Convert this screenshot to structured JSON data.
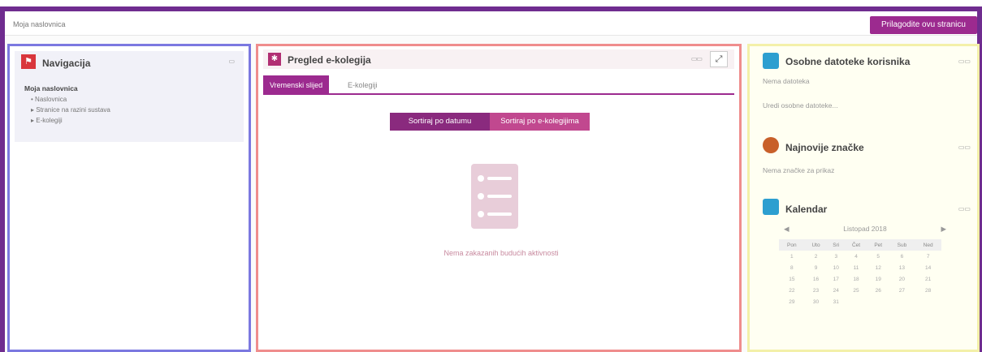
{
  "breadcrumb": "Moja naslovnica",
  "customize_button": "Prilagodite ovu stranicu",
  "navigation": {
    "title": "Navigacija",
    "root": "Moja naslovnica",
    "items": [
      {
        "label": "Naslovnica",
        "marker": "•"
      },
      {
        "label": "Stranice na razini sustava",
        "marker": "▸"
      },
      {
        "label": "E-kolegiji",
        "marker": "▸"
      }
    ]
  },
  "overview": {
    "title": "Pregled e-kolegija",
    "tabs": [
      "Vremenski slijed",
      "E-kolegiji"
    ],
    "sort_buttons": [
      "Sortiraj po datumu",
      "Sortiraj po e-kolegijima"
    ],
    "empty_text": "Nema zakazanih budućih aktivnosti"
  },
  "files": {
    "title": "Osobne datoteke korisnika",
    "empty": "Nema datoteka",
    "edit_link": "Uredi osobne datoteke..."
  },
  "badges": {
    "title": "Najnovije značke",
    "empty": "Nema značke za prikaz"
  },
  "calendar": {
    "title": "Kalendar",
    "month": "Listopad 2018",
    "weekdays": [
      "Pon",
      "Uto",
      "Sri",
      "Čet",
      "Pet",
      "Sub",
      "Ned"
    ],
    "weeks": [
      [
        "1",
        "2",
        "3",
        "4",
        "5",
        "6",
        "7"
      ],
      [
        "8",
        "9",
        "10",
        "11",
        "12",
        "13",
        "14"
      ],
      [
        "15",
        "16",
        "17",
        "18",
        "19",
        "20",
        "21"
      ],
      [
        "22",
        "23",
        "24",
        "25",
        "26",
        "27",
        "28"
      ],
      [
        "29",
        "30",
        "31",
        "",
        "",
        "",
        ""
      ]
    ]
  },
  "colors": {
    "frame": "#6f2c8f",
    "accent": "#9c2a8f",
    "nav_border": "#7b78e0",
    "mid_border": "#ef8d8d",
    "right_border": "#f3f0a9"
  }
}
